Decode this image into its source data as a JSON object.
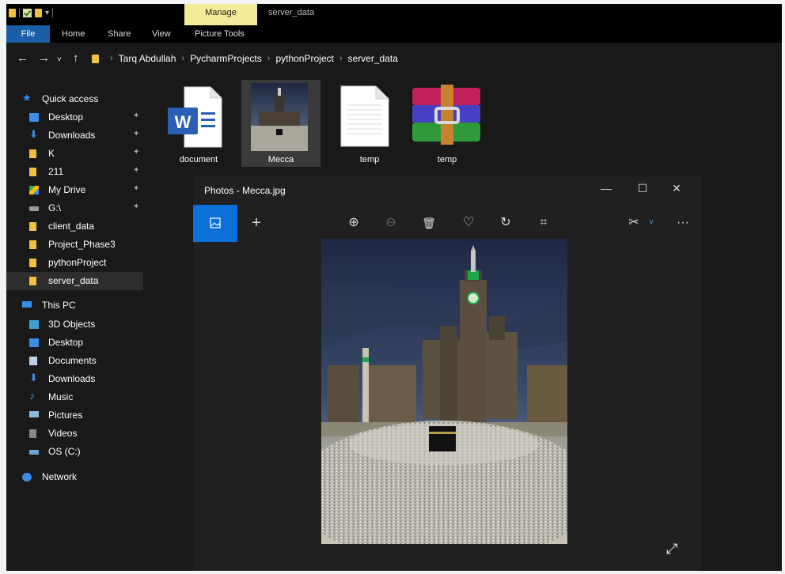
{
  "titlebar": {
    "manage_tab": "Manage",
    "title": "server_data"
  },
  "ribbon": {
    "tabs": [
      "File",
      "Home",
      "Share",
      "View",
      "Picture Tools"
    ]
  },
  "address": {
    "crumbs": [
      "Tarq Abdullah",
      "PycharmProjects",
      "pythonProject",
      "server_data"
    ]
  },
  "sidebar": {
    "quick_access": "Quick access",
    "pinned": [
      {
        "label": "Desktop",
        "icon": "desktop-icon"
      },
      {
        "label": "Downloads",
        "icon": "download-icon"
      },
      {
        "label": "K",
        "icon": "folder-icon"
      },
      {
        "label": "211",
        "icon": "folder-icon"
      },
      {
        "label": "My Drive",
        "icon": "google-drive-icon"
      },
      {
        "label": "G:\\",
        "icon": "drive-icon"
      }
    ],
    "recent": [
      "client_data",
      "Project_Phase3",
      "pythonProject",
      "server_data"
    ],
    "this_pc": "This PC",
    "pc_items": [
      {
        "label": "3D Objects",
        "icon": "cube-icon"
      },
      {
        "label": "Desktop",
        "icon": "desktop-icon"
      },
      {
        "label": "Documents",
        "icon": "document-icon"
      },
      {
        "label": "Downloads",
        "icon": "download-icon"
      },
      {
        "label": "Music",
        "icon": "music-icon"
      },
      {
        "label": "Pictures",
        "icon": "pictures-icon"
      },
      {
        "label": "Videos",
        "icon": "video-icon"
      },
      {
        "label": "OS (C:)",
        "icon": "disk-icon"
      }
    ],
    "network": "Network"
  },
  "files": [
    {
      "name": "document",
      "type": "word-icon"
    },
    {
      "name": "Mecca",
      "type": "image-thumbnail"
    },
    {
      "name": "temp",
      "type": "text-file-icon"
    },
    {
      "name": "temp",
      "type": "winrar-icon"
    }
  ],
  "photos": {
    "title": "Photos - Mecca.jpg",
    "minimize": "—",
    "maximize": "☐",
    "close": "✕",
    "toolbar": {
      "add": "+",
      "zoom_in": "⊕",
      "zoom_out": "⊖",
      "delete": "🗑",
      "favorite": "♡",
      "rotate": "↻",
      "crop": "⌗",
      "edit": "✂",
      "more": "···"
    },
    "expand": "⤢"
  }
}
